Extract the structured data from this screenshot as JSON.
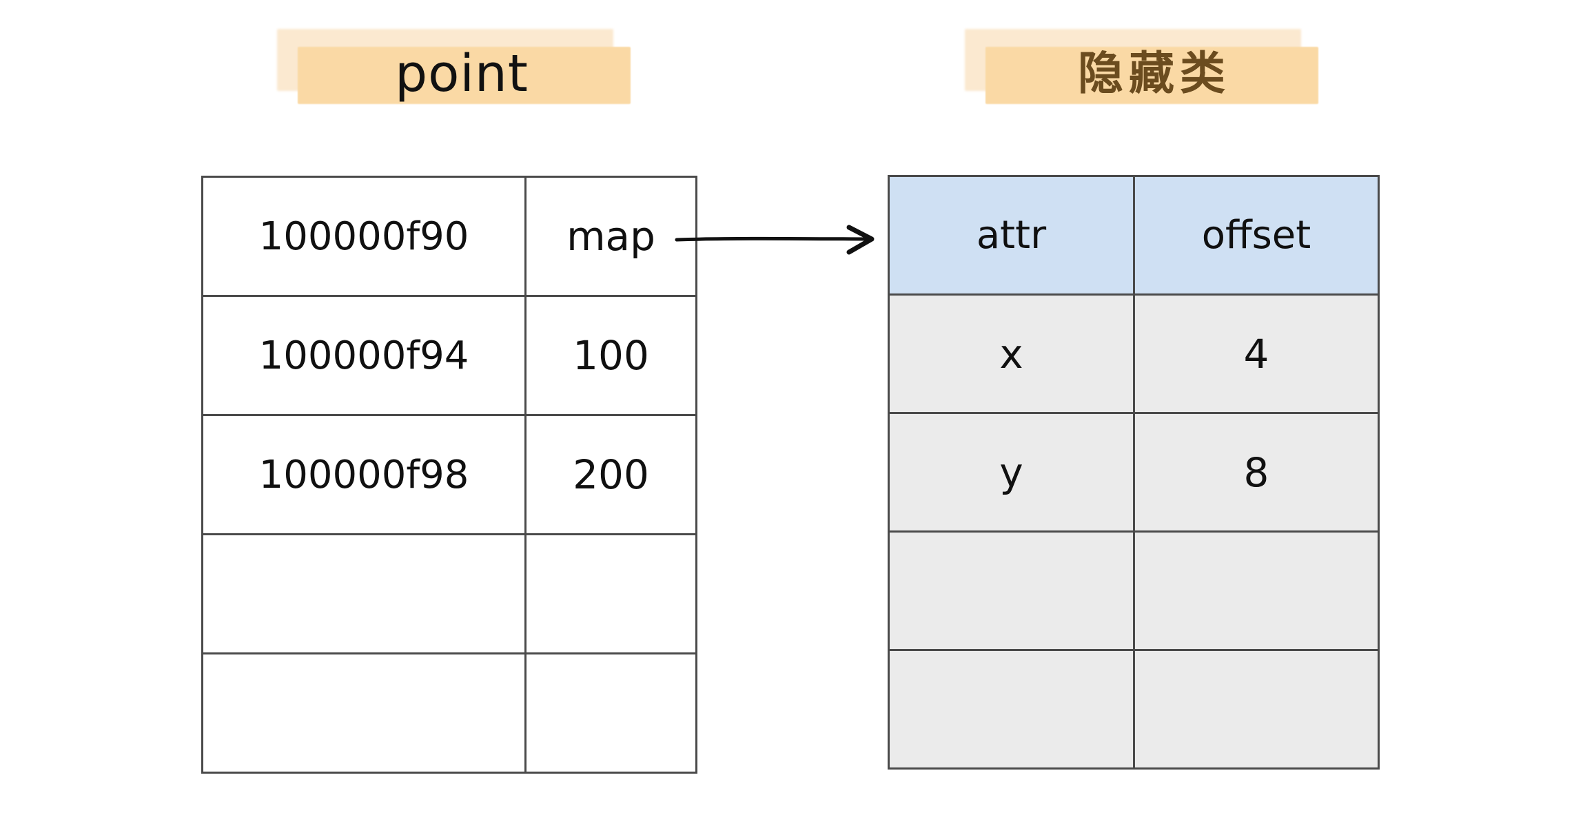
{
  "diagram": {
    "title_labels": {
      "left": {
        "text": "point",
        "highlight_back_color": "#fbe9d0",
        "highlight_front_color": "#fad9a5",
        "text_color": "#111111"
      },
      "right": {
        "text": "隐藏类",
        "highlight_back_color": "#fbe9d0",
        "highlight_front_color": "#fad9a5",
        "text_color": "#6b4c1f"
      }
    },
    "memory_table": {
      "name": "point",
      "row_count": 5,
      "column_count": 2,
      "background_color": "#ffffff",
      "border_color": "#4a4a4a",
      "rows": [
        {
          "address": "100000f90",
          "value": "map"
        },
        {
          "address": "100000f94",
          "value": "100"
        },
        {
          "address": "100000f98",
          "value": "200"
        },
        {
          "address": "",
          "value": ""
        },
        {
          "address": "",
          "value": ""
        }
      ]
    },
    "hidden_class_table": {
      "name": "隐藏类",
      "header_background_color": "#cfe0f3",
      "body_background_color": "#ebebeb",
      "border_color": "#4a4a4a",
      "headers": {
        "attr": "attr",
        "offset": "offset"
      },
      "rows": [
        {
          "attr": "x",
          "offset": "4"
        },
        {
          "attr": "y",
          "offset": "8"
        },
        {
          "attr": "",
          "offset": ""
        },
        {
          "attr": "",
          "offset": ""
        }
      ]
    },
    "arrow": {
      "name": "map-to-hidden-class-arrow",
      "from": "map",
      "to": "attr",
      "color": "#111111"
    }
  }
}
